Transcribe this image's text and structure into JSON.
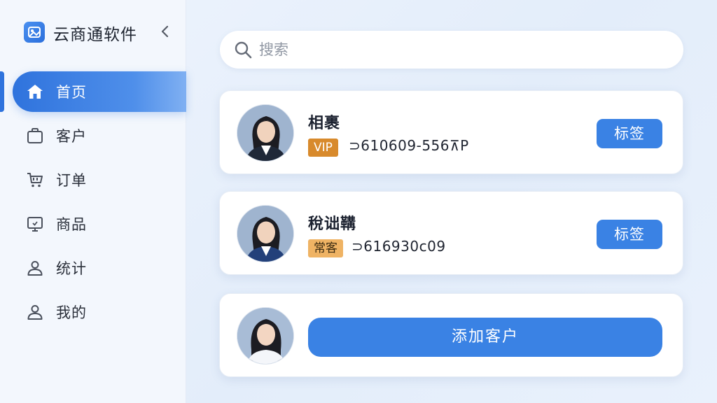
{
  "app": {
    "title": "云商通软件"
  },
  "sidebar": {
    "items": [
      {
        "label": "首页",
        "icon": "home-icon",
        "active": true
      },
      {
        "label": "客户",
        "icon": "briefcase-icon",
        "active": false
      },
      {
        "label": "订单",
        "icon": "cart-icon",
        "active": false
      },
      {
        "label": "商品",
        "icon": "monitor-icon",
        "active": false
      },
      {
        "label": "统计",
        "icon": "user-icon",
        "active": false
      },
      {
        "label": "我的",
        "icon": "user-icon",
        "active": false
      }
    ]
  },
  "search": {
    "placeholder": "搜索",
    "value": ""
  },
  "customers": [
    {
      "name": "相裹",
      "badge": "VIP",
      "phone": "⊃610609-556⊼P",
      "action": "标签"
    },
    {
      "name": "稅诎鞲",
      "badge": "常客",
      "phone": "⊃616930c09",
      "action": "标签"
    }
  ],
  "add_card": {
    "button_label": "添加客户"
  },
  "colors": {
    "accent": "#3a82e4",
    "active_nav": "#2f73dd",
    "vip_badge": "#d88a2c",
    "regular_badge": "#efb364"
  }
}
